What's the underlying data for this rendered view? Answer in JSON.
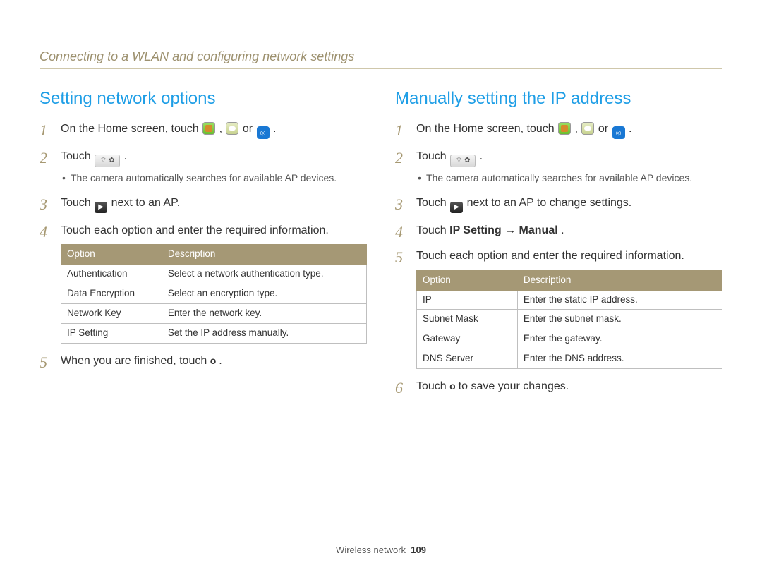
{
  "breadcrumb": "Connecting to a WLAN and configuring network settings",
  "left": {
    "title": "Setting network options",
    "step1_a": "On the Home screen, touch ",
    "step1_b": ", ",
    "step1_c": " or ",
    "step1_d": ".",
    "step2_a": "Touch ",
    "step2_b": ".",
    "step2_note": "The camera automatically searches for available AP devices.",
    "step3_a": "Touch ",
    "step3_b": " next to an AP.",
    "step4": "Touch each option and enter the required information.",
    "table": {
      "headers": [
        "Option",
        "Description"
      ],
      "rows": [
        [
          "Authentication",
          "Select a network authentication type."
        ],
        [
          "Data Encryption",
          "Select an encryption type."
        ],
        [
          "Network Key",
          "Enter the network key."
        ],
        [
          "IP Setting",
          "Set the IP address manually."
        ]
      ]
    },
    "step5_a": "When you are finished, touch ",
    "step5_ok": "o",
    "step5_b": "."
  },
  "right": {
    "title": "Manually setting the IP address",
    "step1_a": "On the Home screen, touch ",
    "step1_b": ", ",
    "step1_c": " or ",
    "step1_d": ".",
    "step2_a": "Touch ",
    "step2_b": ".",
    "step2_note": "The camera automatically searches for available AP devices.",
    "step3_a": "Touch ",
    "step3_b": " next to an AP to change settings.",
    "step4_a": "Touch ",
    "step4_bold": "IP Setting",
    "step4_arrow": " → ",
    "step4_bold2": "Manual",
    "step4_b": ".",
    "step5": "Touch each option and enter the required information.",
    "table": {
      "headers": [
        "Option",
        "Description"
      ],
      "rows": [
        [
          "IP",
          "Enter the static IP address."
        ],
        [
          "Subnet Mask",
          "Enter the subnet mask."
        ],
        [
          "Gateway",
          "Enter the gateway."
        ],
        [
          "DNS Server",
          "Enter the DNS address."
        ]
      ]
    },
    "step6_a": "Touch ",
    "step6_ok": "o",
    "step6_b": " to save your changes."
  },
  "footer": {
    "section": "Wireless network",
    "page": "109"
  }
}
